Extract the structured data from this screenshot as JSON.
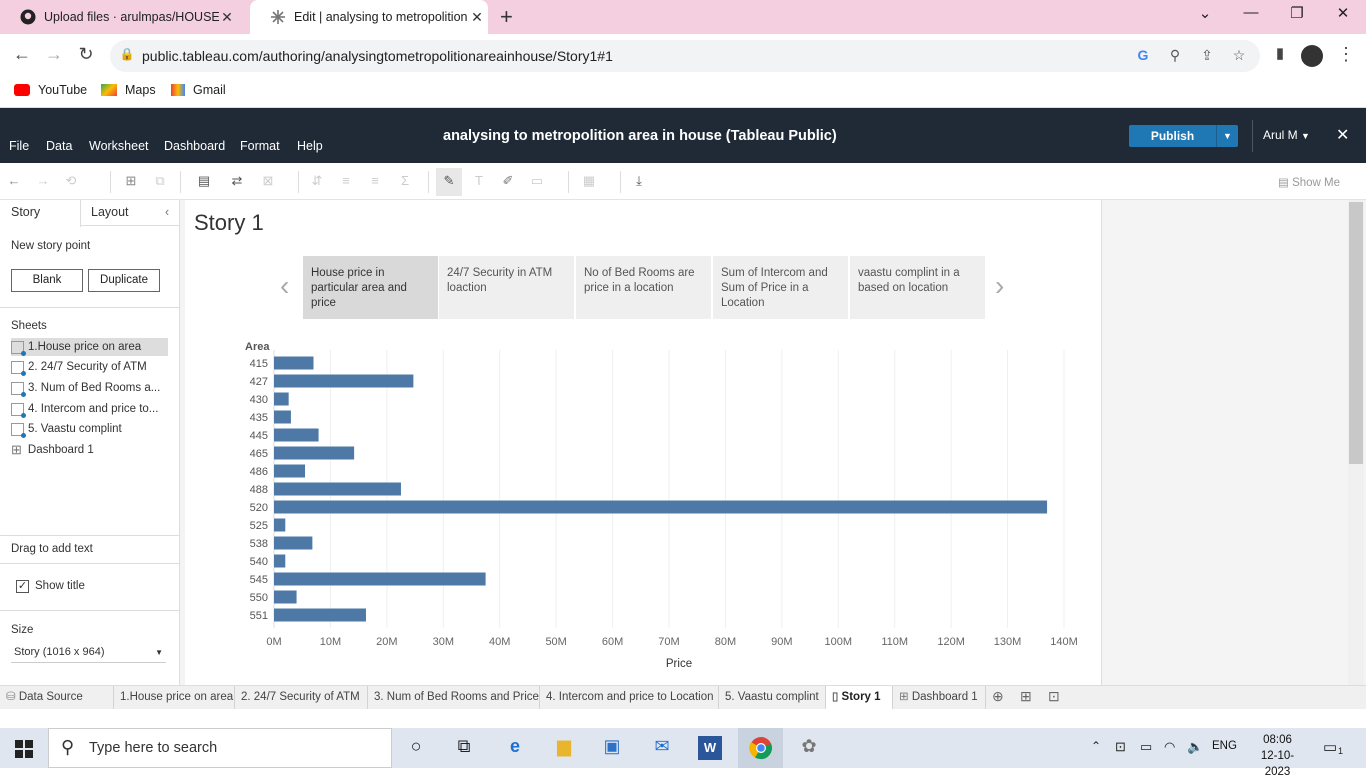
{
  "browser": {
    "tabs": [
      {
        "title": "Upload files · arulmpas/HOUSE_",
        "icon": "github-icon"
      },
      {
        "title": "Edit | analysing to metropolition",
        "icon": "tableau-icon"
      }
    ],
    "url": "public.tableau.com/authoring/analysingtometropolitionareainhouse/Story1#1",
    "bookmarks": [
      "YouTube",
      "Maps",
      "Gmail"
    ]
  },
  "app": {
    "menu": [
      "File",
      "Data",
      "Worksheet",
      "Dashboard",
      "Format",
      "Help"
    ],
    "title": "analysing to metropolition area in house (Tableau Public)",
    "publish_label": "Publish",
    "user": "Arul M",
    "show_me": "Show Me"
  },
  "sidebar": {
    "tabs": [
      "Story",
      "Layout"
    ],
    "new_story_point": "New story point",
    "blank_label": "Blank",
    "duplicate_label": "Duplicate",
    "sheets_header": "Sheets",
    "sheets": [
      "1.House price on area",
      "2. 24/7 Security of ATM",
      "3. Num of Bed Rooms a...",
      "4. Intercom and price to...",
      "5. Vaastu complint",
      "Dashboard 1"
    ],
    "drag_text": "Drag to add text",
    "show_title": "Show title",
    "size_header": "Size",
    "size_value": "Story (1016 x 964)"
  },
  "story": {
    "title": "Story 1",
    "points": [
      "House  price in particular area and price",
      "24/7 Security in ATM loaction",
      "No of Bed Rooms are price in a location",
      "Sum of Intercom and Sum of Price in a Location",
      "vaastu complint in a based on location"
    ]
  },
  "chart_data": {
    "type": "bar",
    "orientation": "horizontal",
    "ylabel": "Area",
    "xlabel": "Price",
    "categories": [
      "415",
      "427",
      "430",
      "435",
      "445",
      "465",
      "486",
      "488",
      "520",
      "525",
      "538",
      "540",
      "545",
      "550",
      "551"
    ],
    "values": [
      7000000,
      24700000,
      2600000,
      3000000,
      7900000,
      14200000,
      5500000,
      22500000,
      137000000,
      2000000,
      6800000,
      2000000,
      37500000,
      4000000,
      16300000
    ],
    "xticks": [
      "0M",
      "10M",
      "20M",
      "30M",
      "40M",
      "50M",
      "60M",
      "70M",
      "80M",
      "90M",
      "100M",
      "110M",
      "120M",
      "130M",
      "140M"
    ],
    "xlim": [
      0,
      140000000
    ],
    "grid": "vertical",
    "bar_color": "#4e79a7"
  },
  "bottom_tabs": [
    "Data Source",
    "1.House price on area",
    "2. 24/7 Security of ATM",
    "3. Num of Bed Rooms and Price",
    "4. Intercom and price to Location",
    "5. Vaastu complint",
    "Story 1",
    "Dashboard 1"
  ],
  "taskbar": {
    "search_placeholder": "Type here to search",
    "language": "ENG",
    "time": "08:06",
    "date": "12-10-2023",
    "notification_count": "1"
  }
}
